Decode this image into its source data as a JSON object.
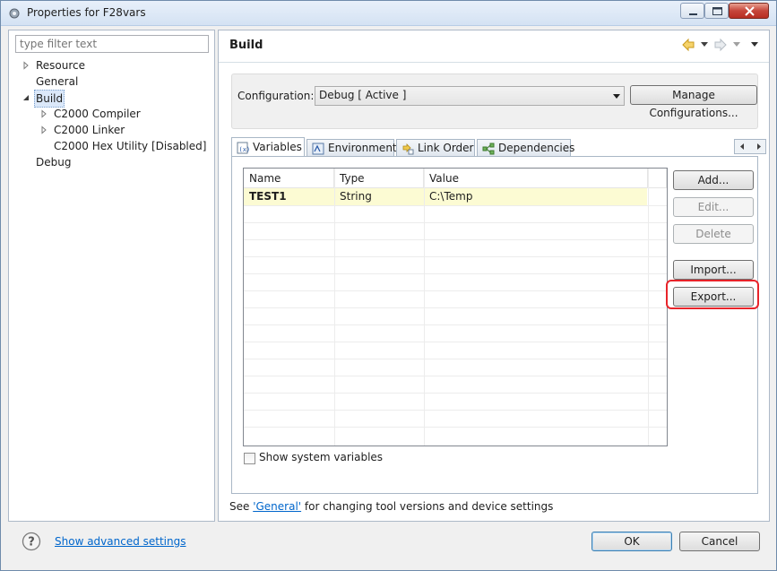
{
  "window": {
    "title": "Properties for F28vars"
  },
  "tree": {
    "filter_placeholder": "type filter text",
    "items": [
      {
        "label": "Resource"
      },
      {
        "label": "General"
      },
      {
        "label": "Build"
      },
      {
        "label": "C2000 Compiler"
      },
      {
        "label": "C2000 Linker"
      },
      {
        "label": "C2000 Hex Utility  [Disabled]"
      },
      {
        "label": "Debug"
      }
    ]
  },
  "page": {
    "title": "Build",
    "configuration_label": "Configuration:",
    "configuration_value": "Debug  [ Active ]",
    "manage_button": "Manage Configurations..."
  },
  "tabs": [
    {
      "label": "Variables",
      "active": true
    },
    {
      "label": "Environment"
    },
    {
      "label": "Link Order"
    },
    {
      "label": "Dependencies"
    }
  ],
  "table": {
    "headers": [
      "Name",
      "Type",
      "Value"
    ],
    "rows": [
      {
        "name": "TEST1",
        "type": "String",
        "value": "C:\\Temp"
      }
    ]
  },
  "side_buttons": {
    "add": "Add...",
    "edit": "Edit...",
    "delete": "Delete",
    "import": "Import...",
    "export": "Export..."
  },
  "show_system_variables": {
    "label": "Show system variables",
    "checked": false
  },
  "footer": {
    "prefix": "See ",
    "link": "'General'",
    "suffix": " for changing tool versions and device settings"
  },
  "bottom": {
    "advanced_link": "Show advanced settings",
    "ok": "OK",
    "cancel": "Cancel"
  },
  "colors": {
    "highlight": "#e8242a",
    "selected_row": "#fcfbd3",
    "link": "#0066cc"
  }
}
